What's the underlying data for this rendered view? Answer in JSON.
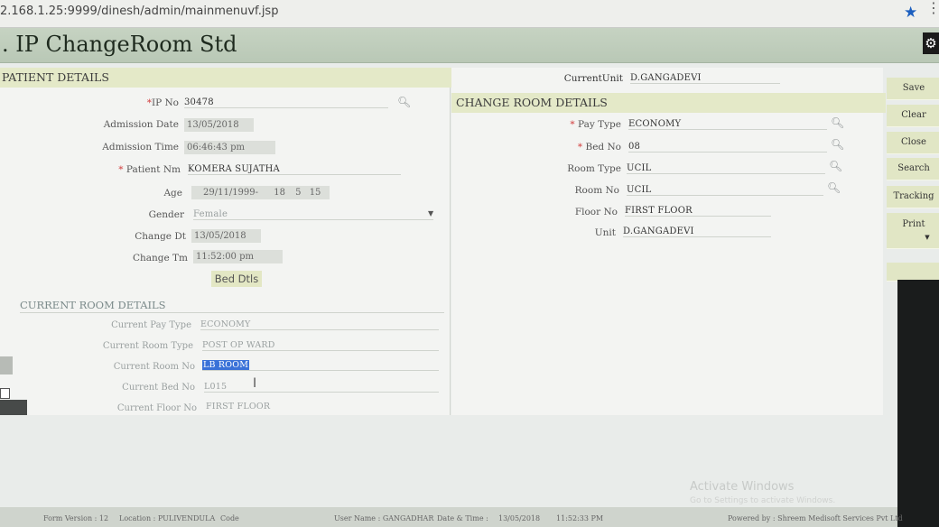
{
  "browser": {
    "url": "2.168.1.25:9999/dinesh/admin/mainmenuvf.jsp",
    "bookmark_icon": "star-icon"
  },
  "app": {
    "title": "IP ChangeRoom Std",
    "settings_icon": "gear-icon"
  },
  "patient": {
    "header": "PATIENT DETAILS",
    "ip_no_label": "IP No",
    "ip_no": "30478",
    "admission_date_label": "Admission Date",
    "admission_date": "13/05/2018",
    "admission_time_label": "Admission Time",
    "admission_time": "06:46:43 pm",
    "patient_nm_label": "Patient Nm",
    "patient_nm": "KOMERA SUJATHA",
    "age_label": "Age",
    "dob": "29/11/1999-",
    "age_y": "18",
    "age_m": "5",
    "age_d": "15",
    "gender_label": "Gender",
    "gender": "Female",
    "change_dt_label": "Change Dt",
    "change_dt": "13/05/2018",
    "change_tm_label": "Change Tm",
    "change_tm": "11:52:00 pm",
    "bed_dtls_button": "Bed Dtls"
  },
  "current_room": {
    "header": "CURRENT ROOM DETAILS",
    "pay_type_label": "Current Pay Type",
    "pay_type": "ECONOMY",
    "room_type_label": "Current Room Type",
    "room_type": "POST OP WARD",
    "room_no_label": "Current Room No",
    "room_no": "LB ROOM",
    "bed_no_label": "Current Bed No",
    "bed_no": "L015",
    "floor_no_label": "Current Floor No",
    "floor_no": "FIRST FLOOR"
  },
  "current_unit": {
    "label": "CurrentUnit",
    "value": "D.GANGADEVI"
  },
  "change_room": {
    "header": "CHANGE ROOM DETAILS",
    "pay_type_label": "Pay Type",
    "pay_type": "ECONOMY",
    "bed_no_label": "Bed No",
    "bed_no": "08",
    "room_type_label": "Room Type",
    "room_type": "UCIL",
    "room_no_label": "Room No",
    "room_no": "UCIL",
    "floor_no_label": "Floor No",
    "floor_no": "FIRST FLOOR",
    "unit_label": "Unit",
    "unit": "D.GANGADEVI"
  },
  "actions": {
    "save": "Save",
    "clear": "Clear",
    "close": "Close",
    "search": "Search",
    "tracking": "Tracking",
    "print": "Print"
  },
  "status": {
    "form_version": "Form Version : 12",
    "location": "Location : PULIVENDULA",
    "code": "Code",
    "user_name": "User Name : GANGADHAR",
    "date_time_label": "Date & Time :",
    "date": "13/05/2018",
    "time": "11:52:33 PM",
    "powered_by": "Powered by : Shreem Medisoft Services Pvt Ltd"
  },
  "watermark": {
    "title": "Activate Windows",
    "subtitle": "Go to Settings to activate Windows."
  }
}
